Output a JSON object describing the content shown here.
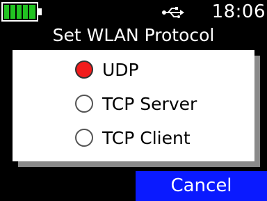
{
  "status_bar": {
    "battery_icon": "battery-full-icon",
    "battery_color": "#22c322",
    "battery_level": 1.0,
    "usb_icon": "usb-icon",
    "time": "18:06"
  },
  "title": "Set WLAN Protocol",
  "dialog": {
    "options": [
      {
        "label": "UDP",
        "selected": true
      },
      {
        "label": "TCP Server",
        "selected": false
      },
      {
        "label": "TCP Client",
        "selected": false
      }
    ],
    "selected_color": "#f21c1c"
  },
  "footer": {
    "cancel_label": "Cancel",
    "cancel_color": "#0a1aff"
  }
}
